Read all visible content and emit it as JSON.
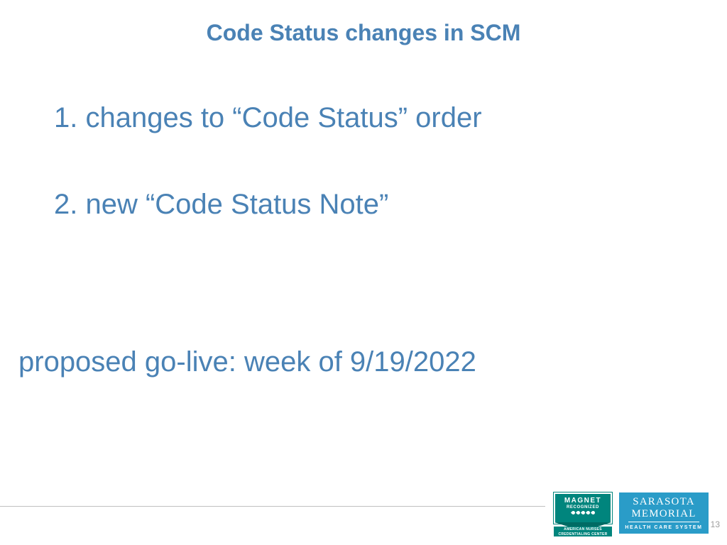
{
  "title": "Code Status changes in SCM",
  "items": [
    "1. changes to “Code Status” order",
    "2. new “Code Status Note”"
  ],
  "golive": "proposed go-live: week of 9/19/2022",
  "pageNumber": "13",
  "logos": {
    "magnet": {
      "word": "MAGNET",
      "sub": "RECOGNIZED",
      "bar1": "AMERICAN NURSES",
      "bar2": "CREDENTIALING CENTER"
    },
    "sarasota": {
      "line1": "SARASOTA",
      "line2": "MEMORIAL",
      "tag": "HEALTH CARE SYSTEM"
    }
  }
}
